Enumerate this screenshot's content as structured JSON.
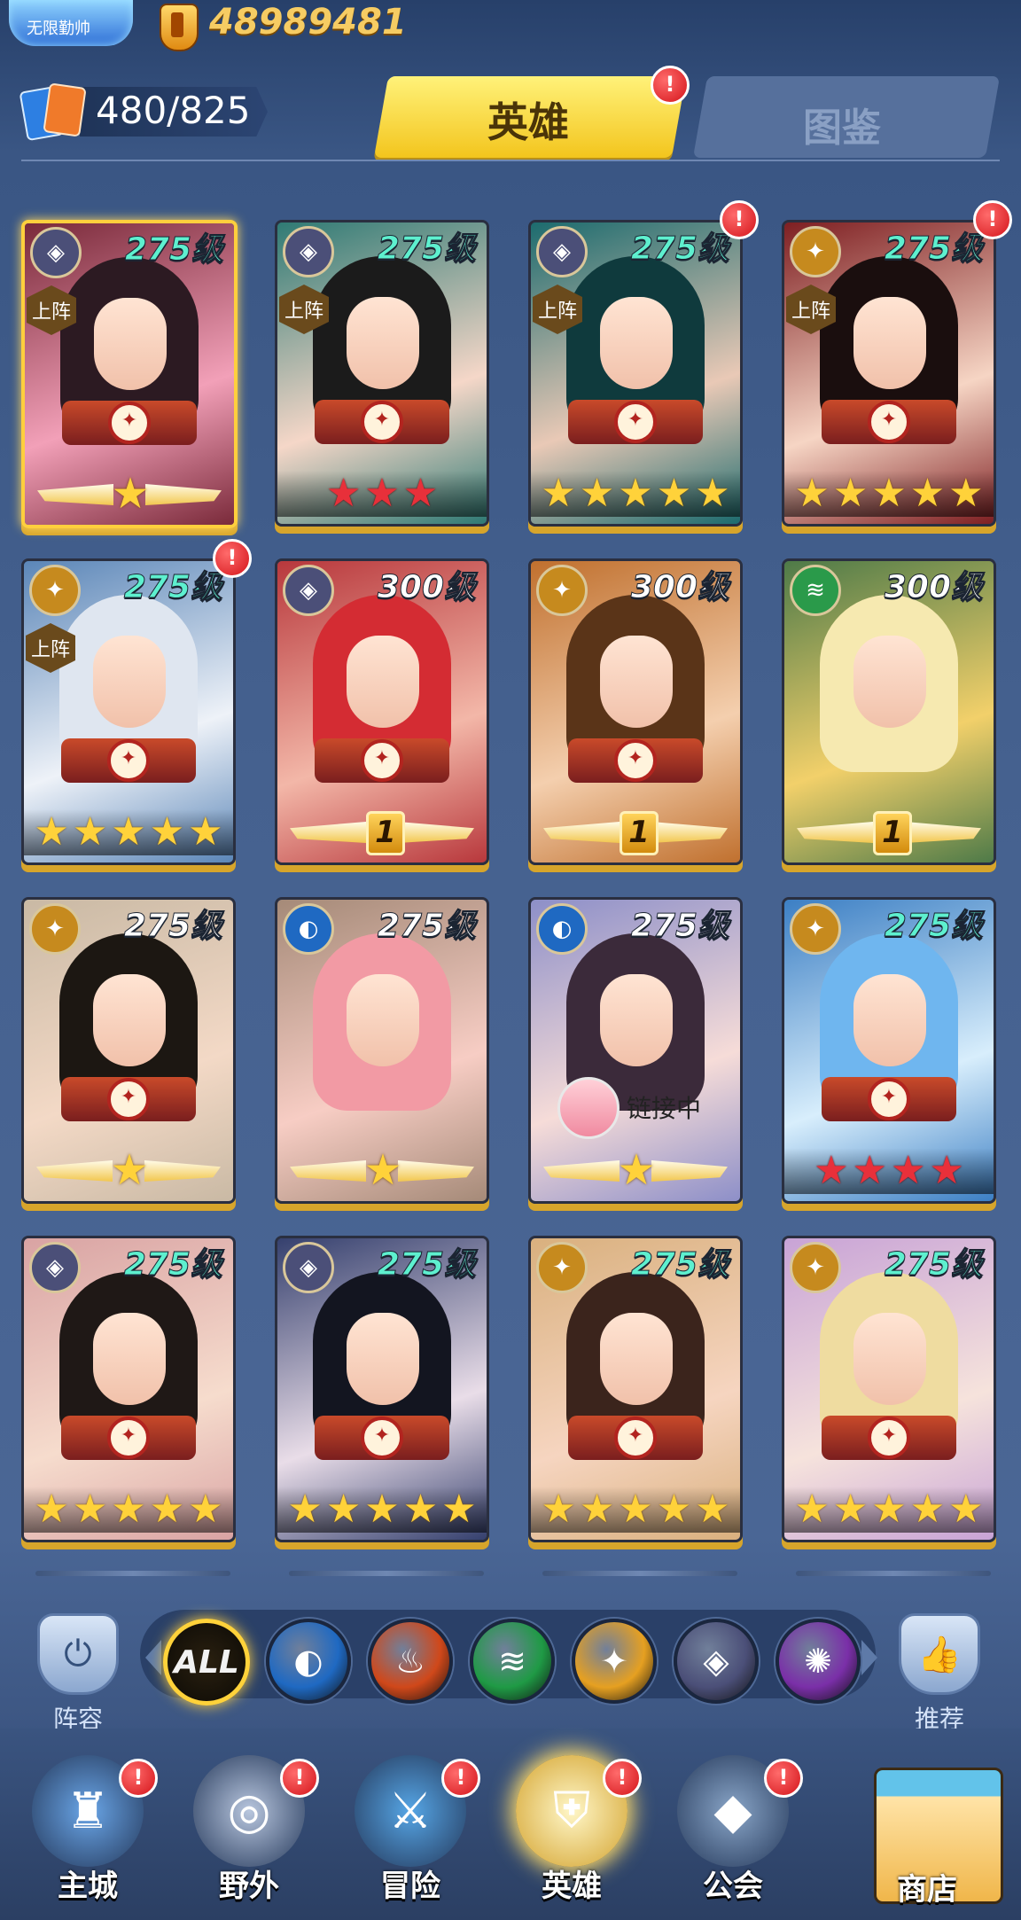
{
  "header": {
    "rank_title": "无限勤帅",
    "currency_value": "48989481",
    "hero_count": "480/825",
    "tabs": [
      {
        "label": "英雄",
        "active": true,
        "has_alert": true
      },
      {
        "label": "图鉴",
        "active": false
      }
    ]
  },
  "alert_mark": "!",
  "cards": [
    {
      "level": "275级",
      "level_color": "#5ef0cf",
      "faction": "shadow",
      "faction_glyph": "◈",
      "faction_color": "#4b4f78",
      "deploy": "上阵",
      "rank_type": "wings",
      "rank_value": "",
      "stars": 0,
      "star_color": "gold",
      "emblem": "dragon",
      "alert": false,
      "selected": true,
      "palette": [
        "#7a2a3a",
        "#f2a0b8",
        "#2c1a22"
      ]
    },
    {
      "level": "275级",
      "level_color": "#5ef0cf",
      "faction": "shadow",
      "faction_glyph": "◈",
      "faction_color": "#4b4f78",
      "deploy": "上阵",
      "rank_type": "stars",
      "stars": 3,
      "star_color": "red",
      "emblem": "dragon",
      "alert": false,
      "selected": false,
      "palette": [
        "#2f7a74",
        "#f5d7c8",
        "#1b1b1b"
      ]
    },
    {
      "level": "275级",
      "level_color": "#5ef0cf",
      "faction": "shadow",
      "faction_glyph": "◈",
      "faction_color": "#4b4f78",
      "deploy": "上阵",
      "rank_type": "stars",
      "stars": 5,
      "star_color": "gold",
      "emblem": "dragon",
      "alert": true,
      "selected": false,
      "palette": [
        "#1c6b6e",
        "#e9c9b6",
        "#0f3a3d"
      ]
    },
    {
      "level": "275级",
      "level_color": "#5ef0cf",
      "faction": "light",
      "faction_glyph": "✦",
      "faction_color": "#c68a1e",
      "deploy": "上阵",
      "rank_type": "stars",
      "stars": 5,
      "star_color": "gold",
      "emblem": "dragon",
      "alert": true,
      "selected": false,
      "palette": [
        "#7e1f22",
        "#f6d5c4",
        "#1a0e0e"
      ]
    },
    {
      "level": "275级",
      "level_color": "#5ef0cf",
      "faction": "light",
      "faction_glyph": "✦",
      "faction_color": "#c68a1e",
      "deploy": "上阵",
      "rank_type": "stars",
      "stars": 5,
      "star_color": "gold",
      "emblem": "dragon",
      "alert": true,
      "selected": false,
      "palette": [
        "#5b86b8",
        "#eef2f8",
        "#dfe6f0"
      ]
    },
    {
      "level": "300级",
      "level_color": "#ffffff",
      "faction": "shadow",
      "faction_glyph": "◈",
      "faction_color": "#4b4f78",
      "deploy": "",
      "rank_type": "number",
      "rank_value": "1",
      "stars": 0,
      "star_color": "gold",
      "emblem": "cross",
      "alert": false,
      "selected": false,
      "palette": [
        "#b8383c",
        "#f3b7a8",
        "#d42c33"
      ]
    },
    {
      "level": "300级",
      "level_color": "#ffffff",
      "faction": "light",
      "faction_glyph": "✦",
      "faction_color": "#c68a1e",
      "deploy": "",
      "rank_type": "number",
      "rank_value": "1",
      "stars": 0,
      "star_color": "gold",
      "emblem": "beast",
      "alert": false,
      "selected": false,
      "palette": [
        "#c0702e",
        "#f4cfae",
        "#5a3418"
      ]
    },
    {
      "level": "300级",
      "level_color": "#ffffff",
      "faction": "wind",
      "faction_glyph": "≋",
      "faction_color": "#2a9a4a",
      "deploy": "",
      "rank_type": "number",
      "rank_value": "1",
      "stars": 0,
      "star_color": "gold",
      "emblem": "none",
      "alert": false,
      "selected": false,
      "palette": [
        "#4e7a48",
        "#f2d06a",
        "#f6e9b0"
      ]
    },
    {
      "level": "275级",
      "level_color": "#ffffff",
      "faction": "light",
      "faction_glyph": "✦",
      "faction_color": "#c68a1e",
      "deploy": "",
      "rank_type": "wings",
      "rank_value": "",
      "stars": 0,
      "star_color": "gold",
      "emblem": "cross-red",
      "alert": false,
      "selected": false,
      "palette": [
        "#c9b9a4",
        "#f3d9c6",
        "#1c1712"
      ]
    },
    {
      "level": "275级",
      "level_color": "#ffffff",
      "faction": "water",
      "faction_glyph": "◐",
      "faction_color": "#1f69c2",
      "deploy": "",
      "rank_type": "wings",
      "rank_value": "",
      "stars": 0,
      "star_color": "gold",
      "emblem": "none",
      "alert": false,
      "selected": false,
      "palette": [
        "#a58a78",
        "#f7cdc4",
        "#f29aa4"
      ]
    },
    {
      "level": "275级",
      "level_color": "#ffffff",
      "faction": "water",
      "faction_glyph": "◐",
      "faction_color": "#1f69c2",
      "deploy": "",
      "rank_type": "wings",
      "rank_value": "",
      "stars": 0,
      "star_color": "gold",
      "emblem": "link",
      "link_text": "链接中",
      "alert": false,
      "selected": false,
      "palette": [
        "#8d8fc8",
        "#f6dcd8",
        "#3b2a3a"
      ]
    },
    {
      "level": "275级",
      "level_color": "#5ef0cf",
      "faction": "light",
      "faction_glyph": "✦",
      "faction_color": "#c68a1e",
      "deploy": "",
      "rank_type": "stars",
      "stars": 4,
      "star_color": "red",
      "emblem": "cross",
      "alert": false,
      "selected": false,
      "palette": [
        "#3c7fc4",
        "#d8eefc",
        "#6fb6ef"
      ]
    },
    {
      "level": "275级",
      "level_color": "#5ef0cf",
      "faction": "shadow",
      "faction_glyph": "◈",
      "faction_color": "#4b4f78",
      "deploy": "",
      "rank_type": "stars",
      "stars": 5,
      "star_color": "gold",
      "emblem": "flower",
      "alert": false,
      "selected": false,
      "palette": [
        "#d9a3a3",
        "#f6dccd",
        "#1f1816"
      ]
    },
    {
      "level": "275级",
      "level_color": "#5ef0cf",
      "faction": "shadow",
      "faction_glyph": "◈",
      "faction_color": "#4b4f78",
      "deploy": "",
      "rank_type": "stars",
      "stars": 5,
      "star_color": "gold",
      "emblem": "cross",
      "alert": false,
      "selected": false,
      "palette": [
        "#35406e",
        "#e9dde8",
        "#131520"
      ]
    },
    {
      "level": "275级",
      "level_color": "#5ef0cf",
      "faction": "light",
      "faction_glyph": "✦",
      "faction_color": "#c68a1e",
      "deploy": "",
      "rank_type": "stars",
      "stars": 5,
      "star_color": "gold",
      "emblem": "dragon",
      "alert": false,
      "selected": false,
      "palette": [
        "#d9b07e",
        "#f6d5c0",
        "#3b241c"
      ]
    },
    {
      "level": "275级",
      "level_color": "#5ef0cf",
      "faction": "light",
      "faction_glyph": "✦",
      "faction_color": "#c68a1e",
      "deploy": "",
      "rank_type": "stars",
      "stars": 5,
      "star_color": "gold",
      "emblem": "dragon",
      "alert": false,
      "selected": false,
      "palette": [
        "#c8a3d6",
        "#f6e3dc",
        "#efdca0"
      ]
    }
  ],
  "filter": {
    "left_label": "阵容",
    "right_label": "推荐",
    "all_label": "ALL",
    "factions": [
      {
        "name": "water",
        "glyph": "◐",
        "color": "#1f69c2"
      },
      {
        "name": "fire",
        "glyph": "♨",
        "color": "#d0481a"
      },
      {
        "name": "wind",
        "glyph": "≋",
        "color": "#1f9a45"
      },
      {
        "name": "light",
        "glyph": "✦",
        "color": "#e6a021"
      },
      {
        "name": "shadow",
        "glyph": "◈",
        "color": "#4b4f78"
      },
      {
        "name": "arcane",
        "glyph": "✺",
        "color": "#7a2fa8"
      }
    ]
  },
  "nav": [
    {
      "label": "主城",
      "glyph": "♜",
      "color": "#6aa6e8",
      "alert": true,
      "active": false
    },
    {
      "label": "野外",
      "glyph": "◎",
      "color": "#b8c6de",
      "alert": true,
      "active": false
    },
    {
      "label": "冒险",
      "glyph": "⚔",
      "color": "#56a6e6",
      "alert": true,
      "active": false
    },
    {
      "label": "英雄",
      "glyph": "⛨",
      "color": "#c7b88a",
      "alert": true,
      "active": true
    },
    {
      "label": "公会",
      "glyph": "◆",
      "color": "#8aa6c8",
      "alert": true,
      "active": false
    }
  ],
  "shop_label": "商店"
}
